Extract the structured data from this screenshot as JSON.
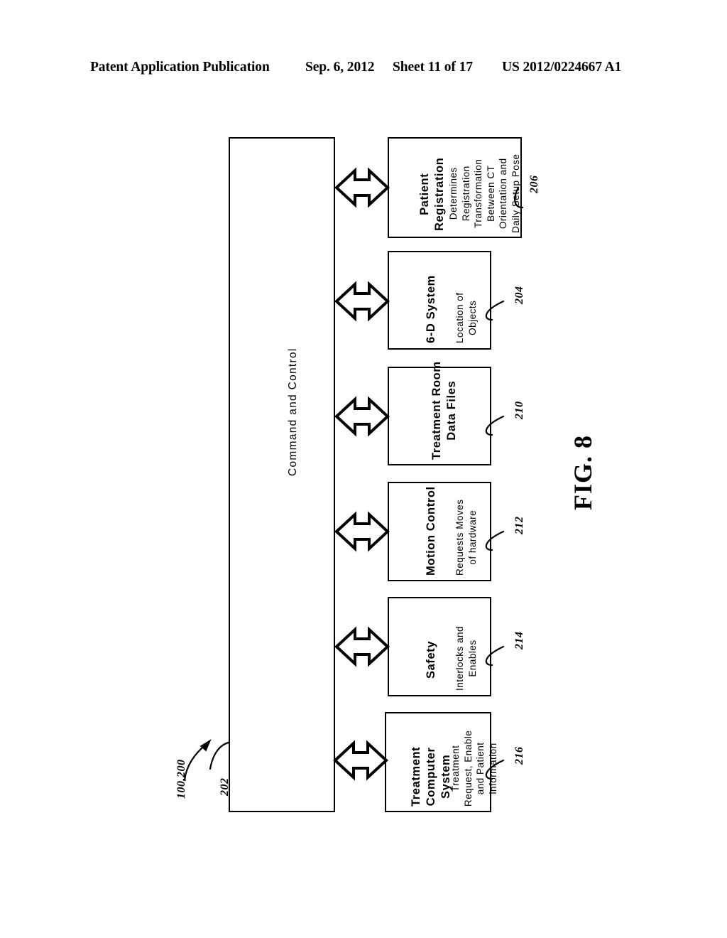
{
  "header": {
    "publication": "Patent Application Publication",
    "date": "Sep. 6, 2012",
    "sheet": "Sheet 11 of 17",
    "patent_number": "US 2012/0224667 A1"
  },
  "figure": {
    "caption": "FIG. 8",
    "system_ref": "100,200",
    "main_block": {
      "label": "Command and Control",
      "ref": "202"
    },
    "modules": [
      {
        "ref": "206",
        "title_lines": [
          "Patient",
          "Registration"
        ],
        "desc_lines": [
          "Determines",
          "Registration",
          "Transformation",
          "Between CT",
          "Orientation and",
          "Daily Setup Pose"
        ],
        "arrow": "bidirectional-arrow"
      },
      {
        "ref": "204",
        "title_lines": [
          "6-D System"
        ],
        "desc_lines": [
          "Location of",
          "Objects"
        ],
        "arrow": "bidirectional-arrow"
      },
      {
        "ref": "210",
        "title_lines": [
          "Treatment Room",
          "Data Files"
        ],
        "desc_lines": [],
        "arrow": "bidirectional-arrow"
      },
      {
        "ref": "212",
        "title_lines": [
          "Motion Control"
        ],
        "desc_lines": [
          "Requests Moves",
          "of hardware"
        ],
        "arrow": "bidirectional-arrow"
      },
      {
        "ref": "214",
        "title_lines": [
          "Safety"
        ],
        "desc_lines": [
          "Interlocks and",
          "Enables"
        ],
        "arrow": "bidirectional-arrow"
      },
      {
        "ref": "216",
        "title_lines": [
          "Treatment",
          "Computer",
          "System"
        ],
        "desc_lines": [
          "Treatment",
          "Request, Enable",
          "and Patient",
          "information"
        ],
        "arrow": "bidirectional-arrow"
      }
    ]
  },
  "colors": {
    "ink": "#000000",
    "paper": "#ffffff"
  }
}
